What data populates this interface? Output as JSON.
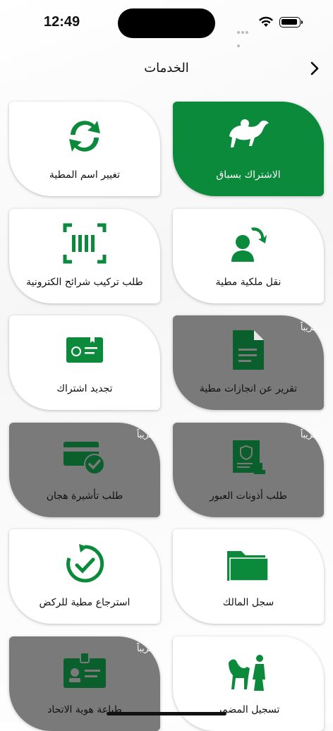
{
  "status": {
    "time": "12:49"
  },
  "header": {
    "title": "الخدمات"
  },
  "colors": {
    "brand_green": "#0a8a3a",
    "soon_gray": "#7a7a7a"
  },
  "cards": [
    {
      "label": "الاشتراك بسباق",
      "badge": "",
      "icon": "camel-race-icon",
      "state": "active"
    },
    {
      "label": "تغيير اسم المطية",
      "badge": "",
      "icon": "refresh-arrows-icon",
      "state": "normal"
    },
    {
      "label": "نقل ملكية مطية",
      "badge": "",
      "icon": "person-transfer-icon",
      "state": "normal"
    },
    {
      "label": "طلب تركيب شرائح الكترونية",
      "badge": "",
      "icon": "barcode-scan-icon",
      "state": "normal"
    },
    {
      "label": "تقرير عن انجازات مطية",
      "badge": "قريباً",
      "icon": "document-icon",
      "state": "soon"
    },
    {
      "label": "تجديد اشتراك",
      "badge": "",
      "icon": "id-card-icon",
      "state": "normal"
    },
    {
      "label": "طلب أذونات العبور",
      "badge": "قريباً",
      "icon": "certificate-stamp-icon",
      "state": "soon"
    },
    {
      "label": "طلب تأشيرة هجان",
      "badge": "قريباً",
      "icon": "card-check-icon",
      "state": "soon"
    },
    {
      "label": "سجل المالك",
      "badge": "",
      "icon": "folder-icon",
      "state": "normal"
    },
    {
      "label": "استرجاع مطية للركض",
      "badge": "",
      "icon": "restore-check-icon",
      "state": "normal"
    },
    {
      "label": "تسجيل المضمر",
      "badge": "",
      "icon": "camel-handler-icon",
      "state": "normal"
    },
    {
      "label": "طباعة هوية الاتحاد",
      "badge": "قريباً",
      "icon": "badge-id-icon",
      "state": "soon"
    }
  ]
}
